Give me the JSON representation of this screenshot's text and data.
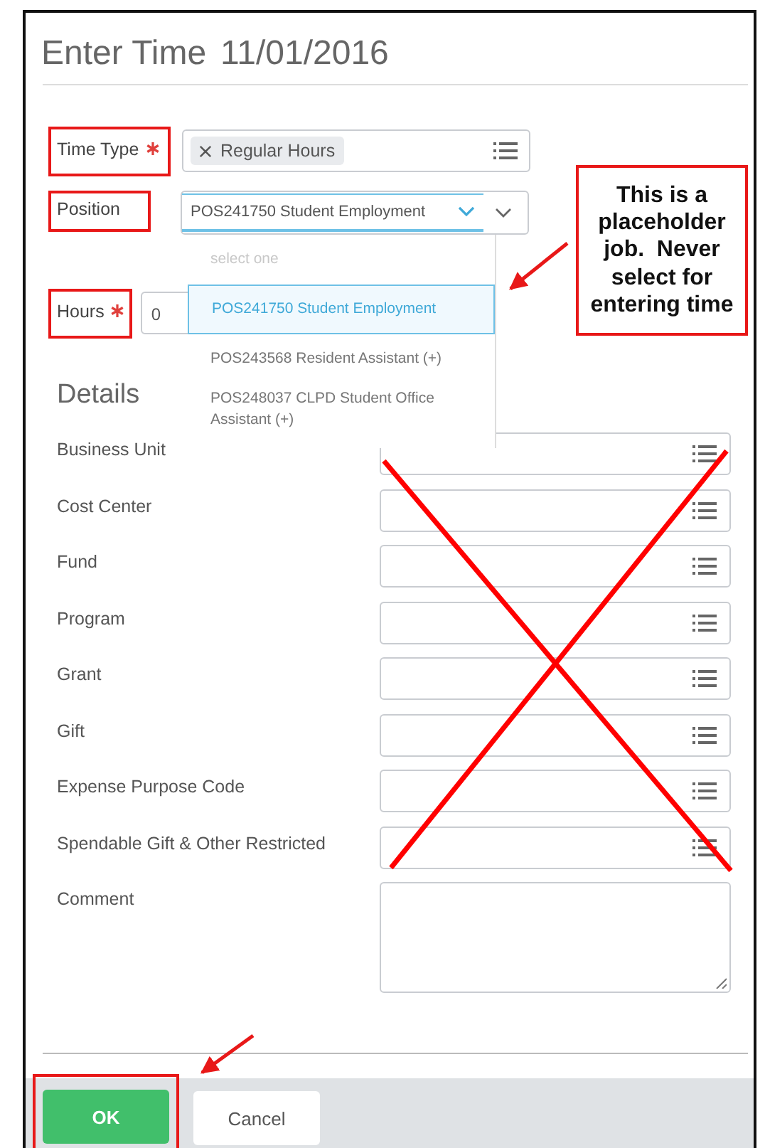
{
  "title": "Enter Time",
  "date": "11/01/2016",
  "fields": [
    {
      "label": "Time Type",
      "required": true,
      "kind": "tag",
      "value": "Regular Hours",
      "highlighted": true
    },
    {
      "label": "Position",
      "required": false,
      "kind": "select",
      "value": "POS241750 Student Employment",
      "highlighted": true
    },
    {
      "label": "Hours",
      "required": true,
      "kind": "number",
      "value": "0",
      "highlighted": true
    }
  ],
  "dropdown": {
    "placeholder": "select one",
    "options": [
      {
        "label": "POS241750 Student Employment",
        "selected": true
      },
      {
        "label": "POS243568 Resident Assistant (+)",
        "selected": false
      },
      {
        "label": "POS248037 CLPD Student Office Assistant (+)",
        "selected": false
      }
    ]
  },
  "details": {
    "heading": "Details",
    "crossed_out": true,
    "fields": [
      {
        "label": "Business Unit",
        "kind": "prompt"
      },
      {
        "label": "Cost Center",
        "kind": "prompt"
      },
      {
        "label": "Fund",
        "kind": "prompt"
      },
      {
        "label": "Program",
        "kind": "prompt"
      },
      {
        "label": "Grant",
        "kind": "prompt"
      },
      {
        "label": "Gift",
        "kind": "prompt"
      },
      {
        "label": "Expense Purpose Code",
        "kind": "prompt"
      },
      {
        "label": "Spendable Gift & Other Restricted",
        "kind": "prompt"
      },
      {
        "label": "Comment",
        "kind": "textarea"
      }
    ]
  },
  "callout": {
    "text": "This is a placeholder job.  Never select for entering time"
  },
  "buttons": [
    {
      "label": "OK",
      "kind": "primary",
      "highlighted": true
    },
    {
      "label": "Cancel",
      "kind": "secondary",
      "highlighted": false
    }
  ]
}
